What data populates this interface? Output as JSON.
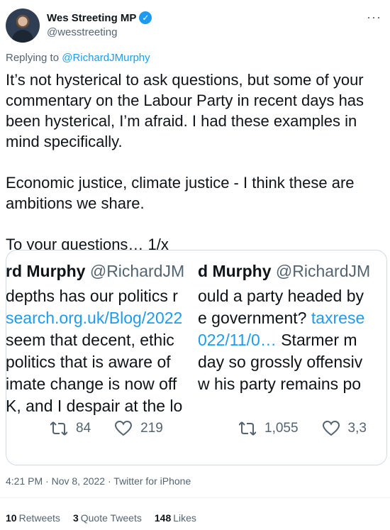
{
  "author": {
    "name": "Wes Streeting MP",
    "handle": "@wesstreeting",
    "verified_mark": "✓"
  },
  "reply": {
    "prefix": "Replying to ",
    "to": "@RichardJMurphy"
  },
  "tweet": {
    "text": "It’s not hysterical to ask questions, but some of your commentary on the Labour Party in recent days has been hysterical, I’m afraid. I had these examples in mind specifically.\n\nEconomic justice, climate justice - I think these are ambitions we share.\n\nTo your questions… 1/x"
  },
  "quote_left": {
    "title_name": "rd Murphy",
    "title_handle": "@RichardJM",
    "lines": [
      "depths has our politics r",
      "search.org.uk/Blog/2022",
      "seem that decent, ethic",
      "politics that is aware of",
      "imate change is now off",
      "K, and I despair at the lo"
    ],
    "retweets": "84",
    "likes": "219"
  },
  "quote_right": {
    "title_name": "d Murphy",
    "title_handle": "@RichardJM",
    "lines": [
      "ould a party headed by",
      "e government? ",
      "022/11/0… Starmer m",
      "day so grossly offensiv",
      "w his party remains po"
    ],
    "link_part": "taxrese",
    "link_line3": "022/11/0…",
    "line3_rest": " Starmer m",
    "retweets": "1,055",
    "likes": "3,3"
  },
  "meta": {
    "time": "4:21 PM",
    "date": "Nov 8, 2022",
    "source": "Twitter for iPhone",
    "separator": "·"
  },
  "stats": {
    "retweets_count": "10",
    "retweets_label": "Retweets",
    "quotes_count": "3",
    "quotes_label": "Quote Tweets",
    "likes_count": "148",
    "likes_label": "Likes"
  },
  "icons": [
    "more-options-icon",
    "verified-badge-icon",
    "retweet-icon",
    "like-icon"
  ],
  "colors": {
    "accent": "#1d9bf0",
    "muted": "#536471",
    "text": "#0f1419"
  }
}
